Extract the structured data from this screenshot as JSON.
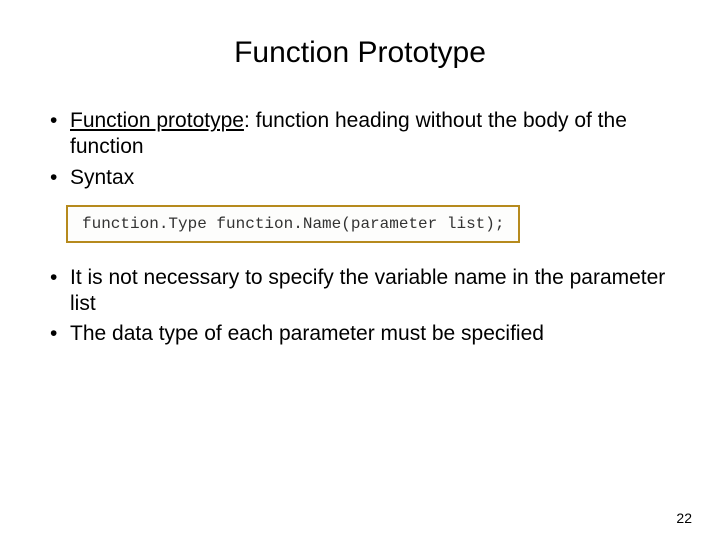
{
  "title": "Function Prototype",
  "bullets_top": [
    {
      "term": "Function prototype",
      "rest": ": function heading without the body of the function"
    },
    {
      "term": "",
      "rest": "Syntax"
    }
  ],
  "code": "function.Type function.Name(parameter list);",
  "bullets_bottom": [
    "It is not necessary to specify the variable name in the parameter list",
    "The data type of each parameter must be specified"
  ],
  "page_number": "22"
}
